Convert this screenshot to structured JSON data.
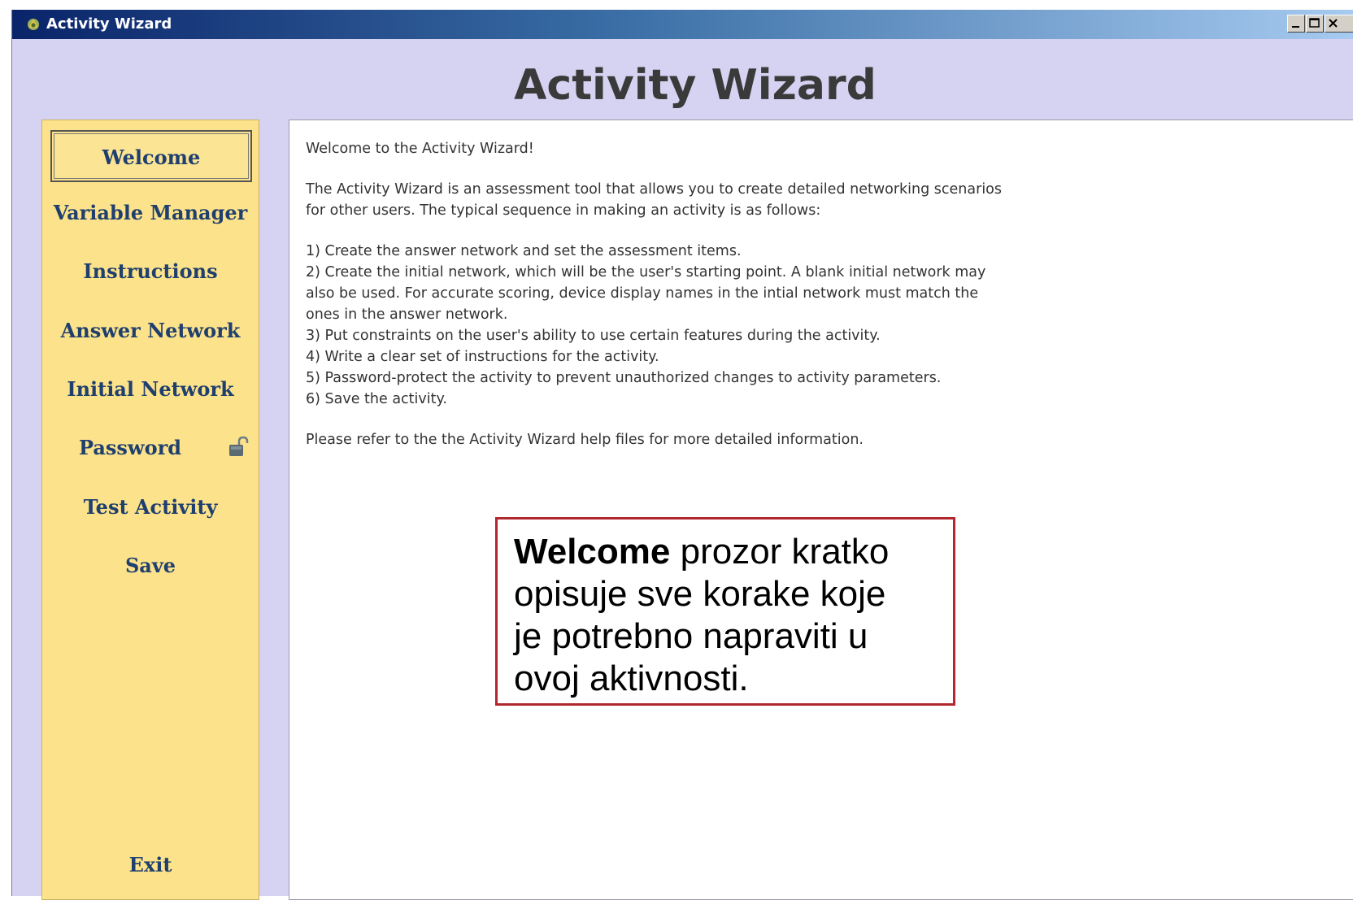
{
  "window": {
    "title": "Activity Wizard",
    "app_icon": "activity-wizard-icon",
    "controls": {
      "minimize_icon": "minimize-icon",
      "maximize_icon": "maximize-icon",
      "close_icon": "close-icon"
    }
  },
  "header": {
    "title": "Activity Wizard"
  },
  "sidebar": {
    "items": [
      {
        "label": "Welcome",
        "active": true
      },
      {
        "label": "Variable Manager"
      },
      {
        "label": "Instructions"
      },
      {
        "label": "Answer Network"
      },
      {
        "label": "Initial Network"
      },
      {
        "label": "Password",
        "icon": "unlocked-padlock-icon"
      },
      {
        "label": "Test Activity"
      },
      {
        "label": "Save"
      },
      {
        "label": "Exit"
      }
    ]
  },
  "content": {
    "greeting": "Welcome to the Activity Wizard!",
    "intro_line1": "The Activity Wizard is an assessment tool that allows you to create detailed networking scenarios",
    "intro_line2": "for other users. The typical sequence in making an activity is as follows:",
    "steps": [
      "1) Create the answer network and set the assessment items.",
      "2) Create the initial network, which will be the user's starting point. A blank initial network may",
      "also be used. For accurate scoring, device display names in the intial network must match the",
      "ones in the answer network.",
      "3) Put constraints on the user's ability to use certain features during the activity.",
      "4) Write a clear set of instructions for the activity.",
      "5) Password-protect the activity to prevent unauthorized changes to activity parameters.",
      "6) Save the activity."
    ],
    "footer_note": "Please refer to the the Activity Wizard help files for more detailed information."
  },
  "callout": {
    "bold": "Welcome",
    "line1_rest": " prozor kratko",
    "line2": "opisuje sve korake koje",
    "line3": "je potrebno napraviti u",
    "line4": "ovoj aktivnosti."
  },
  "colors": {
    "window_bg": "#d6d2f2",
    "sidebar_bg": "#fce28a",
    "nav_text": "#1f3f6e",
    "callout_border": "#b1282e"
  }
}
